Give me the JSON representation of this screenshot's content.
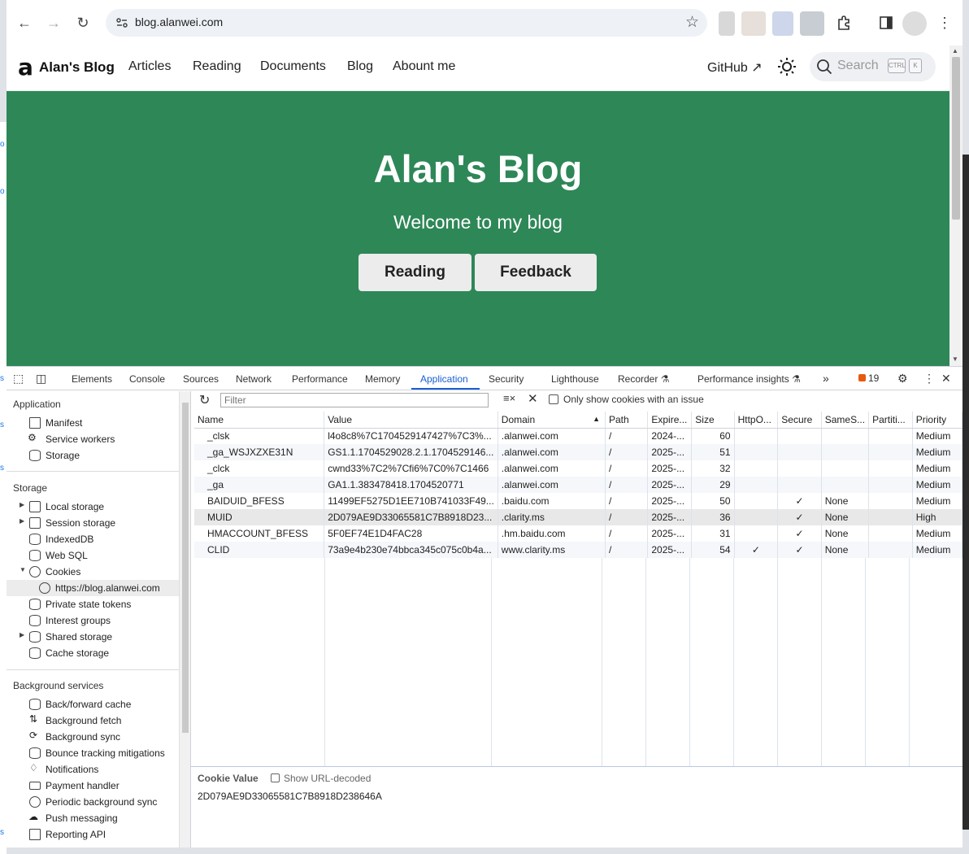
{
  "browser": {
    "url": "blog.alanwei.com"
  },
  "site": {
    "logo": "a",
    "brand": "Alan's Blog",
    "nav": [
      "Articles",
      "Reading",
      "Documents",
      "Blog",
      "Abount me"
    ],
    "github": "GitHub",
    "search_placeholder": "Search",
    "kbd_ctrl": "CTRL",
    "kbd_k": "K"
  },
  "hero": {
    "title": "Alan's Blog",
    "subtitle": "Welcome to my blog",
    "btn_reading": "Reading",
    "btn_feedback": "Feedback",
    "bg_color": "#2e8757"
  },
  "devtools": {
    "tabs": [
      "Elements",
      "Console",
      "Sources",
      "Network",
      "Performance",
      "Memory",
      "Application",
      "Security",
      "Lighthouse",
      "Recorder",
      "Performance insights"
    ],
    "active_tab": "Application",
    "issues_count": "19",
    "sidebar": {
      "application_header": "Application",
      "application_items": [
        "Manifest",
        "Service workers",
        "Storage"
      ],
      "storage_header": "Storage",
      "storage_items": [
        "Local storage",
        "Session storage",
        "IndexedDB",
        "Web SQL",
        "Cookies",
        "https://blog.alanwei.com",
        "Private state tokens",
        "Interest groups",
        "Shared storage",
        "Cache storage"
      ],
      "background_header": "Background services",
      "background_items": [
        "Back/forward cache",
        "Background fetch",
        "Background sync",
        "Bounce tracking mitigations",
        "Notifications",
        "Payment handler",
        "Periodic background sync",
        "Push messaging",
        "Reporting API"
      ]
    },
    "filter_placeholder": "Filter",
    "only_issues_label": "Only show cookies with an issue",
    "columns": [
      "Name",
      "Value",
      "Domain",
      "Path",
      "Expire...",
      "Size",
      "HttpO...",
      "Secure",
      "SameS...",
      "Partiti...",
      "Priority"
    ],
    "cookies": [
      [
        "_clsk",
        "l4o8c8%7C1704529147427%7C3%...",
        ".alanwei.com",
        "/",
        "2024-...",
        "60",
        "",
        "",
        "",
        "",
        "Medium"
      ],
      [
        "_ga_WSJXZXE31N",
        "GS1.1.1704529028.2.1.1704529146...",
        ".alanwei.com",
        "/",
        "2025-...",
        "51",
        "",
        "",
        "",
        "",
        "Medium"
      ],
      [
        "_clck",
        "cwnd33%7C2%7Cfi6%7C0%7C1466",
        ".alanwei.com",
        "/",
        "2025-...",
        "32",
        "",
        "",
        "",
        "",
        "Medium"
      ],
      [
        "_ga",
        "GA1.1.383478418.1704520771",
        ".alanwei.com",
        "/",
        "2025-...",
        "29",
        "",
        "",
        "",
        "",
        "Medium"
      ],
      [
        "BAIDUID_BFESS",
        "11499EF5275D1EE710B741033F49...",
        ".baidu.com",
        "/",
        "2025-...",
        "50",
        "",
        "✓",
        "None",
        "",
        "Medium"
      ],
      [
        "MUID",
        "2D079AE9D33065581C7B8918D23...",
        ".clarity.ms",
        "/",
        "2025-...",
        "36",
        "",
        "✓",
        "None",
        "",
        "High"
      ],
      [
        "HMACCOUNT_BFESS",
        "5F0EF74E1D4FAC28",
        ".hm.baidu.com",
        "/",
        "2025-...",
        "31",
        "",
        "✓",
        "None",
        "",
        "Medium"
      ],
      [
        "CLID",
        "73a9e4b230e74bbca345c075c0b4a...",
        "www.clarity.ms",
        "/",
        "2025-...",
        "54",
        "✓",
        "✓",
        "None",
        "",
        "Medium"
      ]
    ],
    "cookie_value_label": "Cookie Value",
    "show_decoded_label": "Show URL-decoded",
    "cookie_value": "2D079AE9D33065581C7B8918D238646A"
  }
}
